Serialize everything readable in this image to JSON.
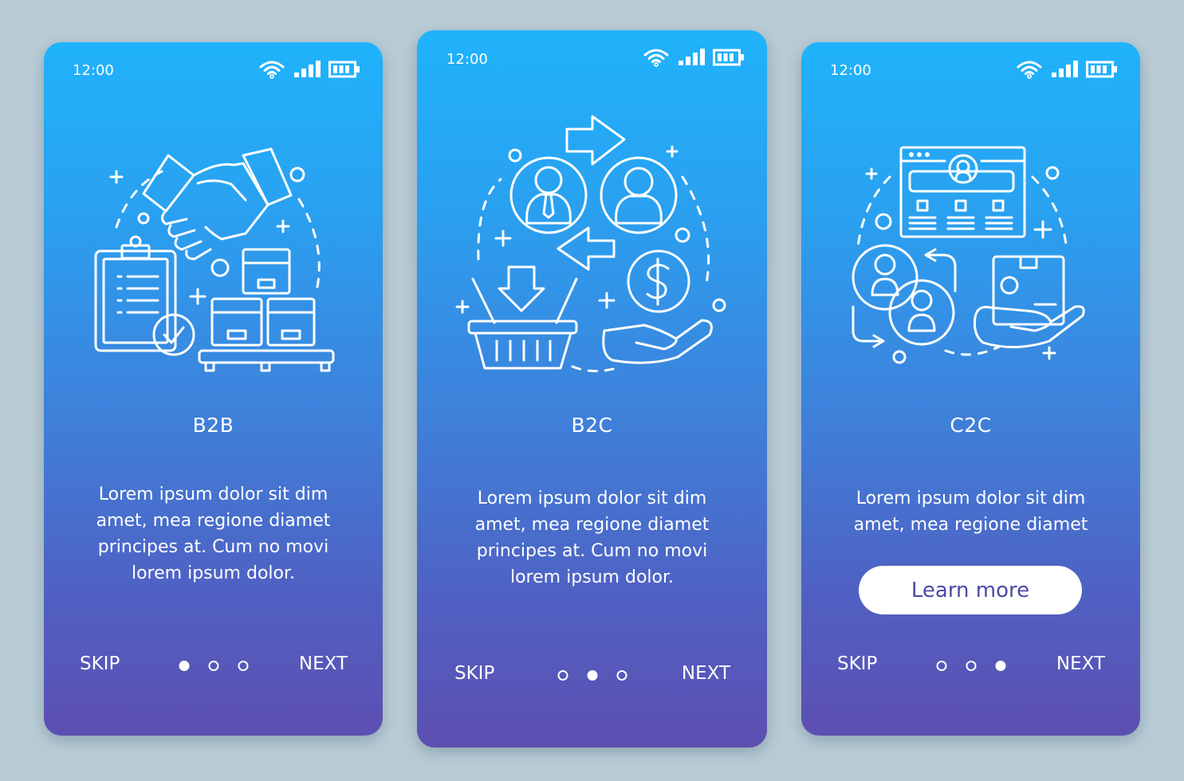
{
  "colors": {
    "background": "#b9ccd6",
    "gradient_top": "#1fb3fb",
    "gradient_bottom": "#5d4fb1",
    "button_text": "#4a4aa8",
    "foreground": "#ffffff"
  },
  "screens": [
    {
      "id": "b2b",
      "status_bar": {
        "time": "12:00",
        "icons": [
          "wifi-icon",
          "signal-icon",
          "battery-icon"
        ]
      },
      "illustration": "handshake-clipboard-boxes-icon",
      "title": "B2B",
      "body_lines": [
        "Lorem ipsum dolor sit dim",
        "amet, mea regione diamet",
        "principes at. Cum no movi",
        "lorem ipsum dolor."
      ],
      "skip_label": "SKIP",
      "next_label": "NEXT",
      "page_indicator": {
        "current": 1,
        "total": 3
      }
    },
    {
      "id": "b2c",
      "status_bar": {
        "time": "12:00",
        "icons": [
          "wifi-icon",
          "signal-icon",
          "battery-icon"
        ]
      },
      "illustration": "business-customer-exchange-icon",
      "title": "B2C",
      "body_lines": [
        "Lorem ipsum dolor sit dim",
        "amet, mea regione diamet",
        "principes at. Cum no movi",
        "lorem ipsum dolor."
      ],
      "skip_label": "SKIP",
      "next_label": "NEXT",
      "page_indicator": {
        "current": 2,
        "total": 3
      }
    },
    {
      "id": "c2c",
      "status_bar": {
        "time": "12:00",
        "icons": [
          "wifi-icon",
          "signal-icon",
          "battery-icon"
        ]
      },
      "illustration": "consumer-marketplace-icon",
      "title": "C2C",
      "body_lines": [
        "Lorem ipsum dolor sit dim",
        "amet, mea regione diamet"
      ],
      "cta_label": "Learn more",
      "skip_label": "SKIP",
      "next_label": "NEXT",
      "page_indicator": {
        "current": 3,
        "total": 3
      }
    }
  ]
}
